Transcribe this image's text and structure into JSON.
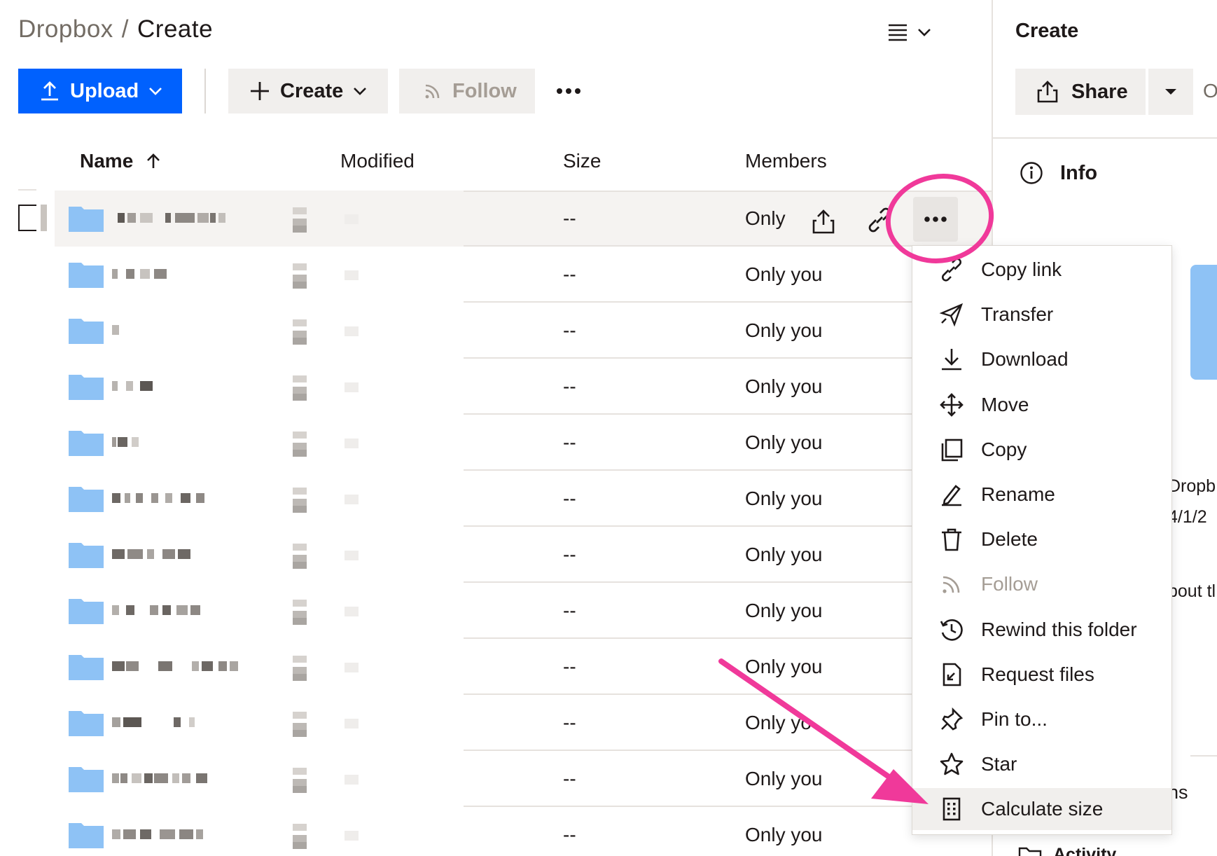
{
  "breadcrumb": {
    "root": "Dropbox",
    "separator": "/",
    "current": "Create"
  },
  "toolbar": {
    "upload_label": "Upload",
    "create_label": "Create",
    "follow_label": "Follow"
  },
  "table": {
    "columns": {
      "name": "Name",
      "modified": "Modified",
      "size": "Size",
      "members": "Members"
    },
    "rows": [
      {
        "size": "--",
        "members": "Only"
      },
      {
        "size": "--",
        "members": "Only you"
      },
      {
        "size": "--",
        "members": "Only you"
      },
      {
        "size": "--",
        "members": "Only you"
      },
      {
        "size": "--",
        "members": "Only you"
      },
      {
        "size": "--",
        "members": "Only you"
      },
      {
        "size": "--",
        "members": "Only you"
      },
      {
        "size": "--",
        "members": "Only you"
      },
      {
        "size": "--",
        "members": "Only you"
      },
      {
        "size": "--",
        "members": "Only yo"
      },
      {
        "size": "--",
        "members": "Only you"
      },
      {
        "size": "--",
        "members": "Only you"
      }
    ]
  },
  "context_menu": {
    "items": [
      {
        "label": "Copy link",
        "icon": "link-icon"
      },
      {
        "label": "Transfer",
        "icon": "paper-plane-icon"
      },
      {
        "label": "Download",
        "icon": "download-icon"
      },
      {
        "label": "Move",
        "icon": "move-arrows-icon"
      },
      {
        "label": "Copy",
        "icon": "copy-icon"
      },
      {
        "label": "Rename",
        "icon": "pencil-icon"
      },
      {
        "label": "Delete",
        "icon": "trash-icon"
      },
      {
        "label": "Follow",
        "icon": "rss-icon",
        "disabled": true
      },
      {
        "label": "Rewind this folder",
        "icon": "rewind-clock-icon"
      },
      {
        "label": "Request files",
        "icon": "request-file-icon"
      },
      {
        "label": "Pin to...",
        "icon": "pin-icon"
      },
      {
        "label": "Star",
        "icon": "star-icon"
      },
      {
        "label": "Calculate size",
        "icon": "calculator-icon",
        "active": true
      }
    ]
  },
  "panel": {
    "title": "Create",
    "share_label": "Share",
    "overflow_text": "O",
    "info_label": "Info",
    "clipped_location": "Dropb",
    "clipped_date": "4/1/2",
    "clipped_about": "bout tl",
    "clipped_section": "ns",
    "clipped_activity": "Activity"
  },
  "colors": {
    "accent": "#0061fe",
    "folder": "#8ec2f5",
    "annotation": "#f0399a"
  }
}
